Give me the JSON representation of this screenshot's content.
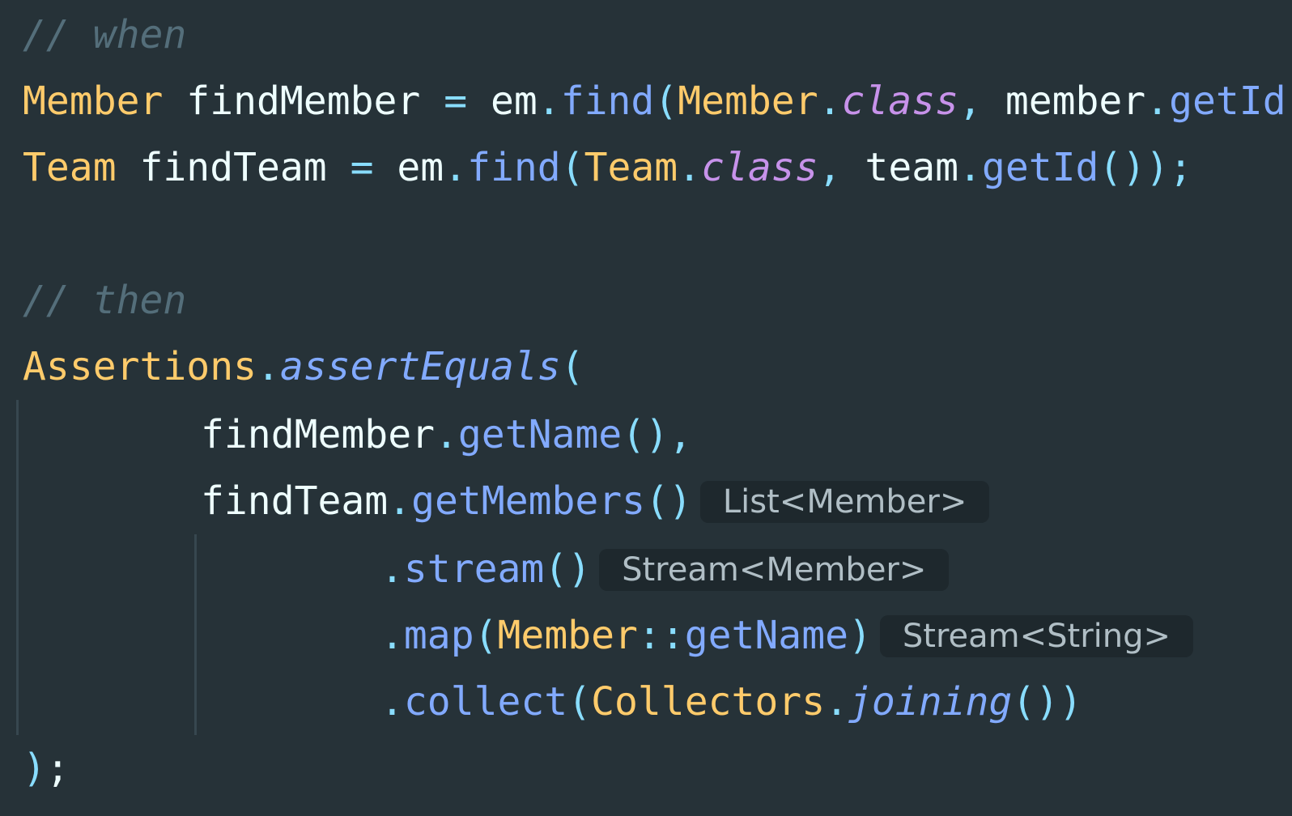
{
  "theme": {
    "background": "#263238",
    "comment": "#546e7a",
    "class": "#ffcb6b",
    "variable": "#eeffff",
    "operator": "#89ddff",
    "method": "#82aaff",
    "keyword": "#c792ea",
    "hint_background": "#1e282d",
    "hint_text": "#b0bec5"
  },
  "code": {
    "comment_when": "// when",
    "line2": {
      "type": "Member",
      "var": "findMember",
      "assign": "=",
      "obj": "em",
      "dot1": ".",
      "method": "find",
      "open": "(",
      "cls": "Member",
      "dot2": ".",
      "kw": "class",
      "comma": ",",
      "arg": "member",
      "dot3": ".",
      "getter": "getId",
      "close": "());"
    },
    "line3": {
      "type": "Team",
      "var": "findTeam",
      "assign": "=",
      "obj": "em",
      "dot1": ".",
      "method": "find",
      "open": "(",
      "cls": "Team",
      "dot2": ".",
      "kw": "class",
      "comma": ",",
      "arg": "team",
      "dot3": ".",
      "getter": "getId",
      "close": "());"
    },
    "comment_then": "// then",
    "line6": {
      "cls": "Assertions",
      "dot": ".",
      "method": "assertEquals",
      "open": "("
    },
    "line7": {
      "var": "findMember",
      "dot": ".",
      "method": "getName",
      "parens": "()",
      "comma": ","
    },
    "line8": {
      "var": "findTeam",
      "dot": ".",
      "method": "getMembers",
      "parens": "()",
      "hint": "List<Member>"
    },
    "line9": {
      "dot": ".",
      "method": "stream",
      "parens": "()",
      "hint": "Stream<Member>"
    },
    "line10": {
      "dot": ".",
      "method": "map",
      "open": "(",
      "cls": "Member",
      "ref": "::",
      "ref_method": "getName",
      "close": ")",
      "hint": "Stream<String>"
    },
    "line11": {
      "dot": ".",
      "method": "collect",
      "open": "(",
      "cls": "Collectors",
      "dot2": ".",
      "static_method": "joining",
      "close": "())"
    },
    "line12": {
      "close": ")",
      "semicolon": ";"
    }
  }
}
